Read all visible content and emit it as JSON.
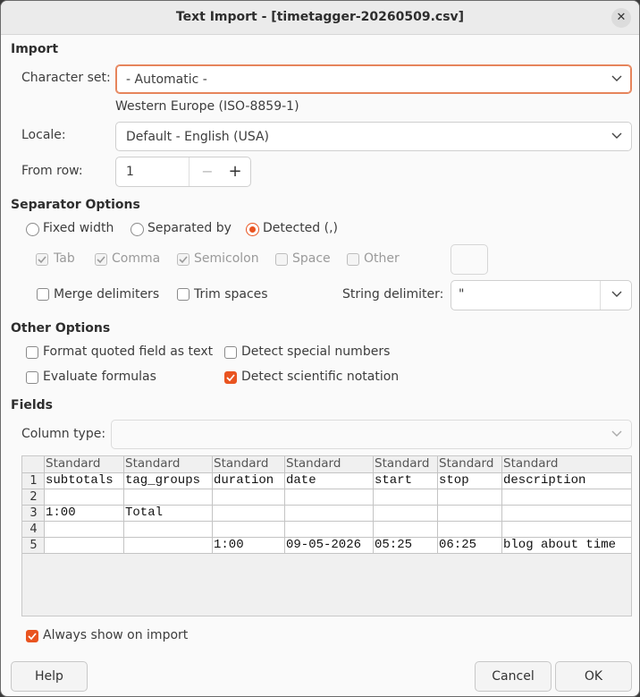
{
  "window": {
    "title": "Text Import - [timetagger-20260509.csv]"
  },
  "import": {
    "section": "Import",
    "charset_label": "Character set:",
    "charset_value": "- Automatic -",
    "charset_detected": "Western Europe (ISO-8859-1)",
    "locale_label": "Locale:",
    "locale_value": "Default - English (USA)",
    "from_row_label": "From row:",
    "from_row_value": "1"
  },
  "separator": {
    "section": "Separator Options",
    "fixed_width": "Fixed width",
    "separated_by": "Separated by",
    "detected": "Detected (,)",
    "selected": "detected",
    "tab": "Tab",
    "comma": "Comma",
    "semicolon": "Semicolon",
    "space": "Space",
    "other": "Other",
    "merge_delimiters": "Merge delimiters",
    "trim_spaces": "Trim spaces",
    "string_delimiter_label": "String delimiter:",
    "string_delimiter_value": "\""
  },
  "other_options": {
    "section": "Other Options",
    "format_quoted": "Format quoted field as text",
    "detect_special": "Detect special numbers",
    "evaluate_formulas": "Evaluate formulas",
    "detect_scientific": "Detect scientific notation"
  },
  "fields": {
    "section": "Fields",
    "column_type_label": "Column type:",
    "column_type_value": "",
    "column_types": [
      "Standard",
      "Standard",
      "Standard",
      "Standard",
      "Standard",
      "Standard",
      "Standard"
    ],
    "row_numbers": [
      "1",
      "2",
      "3",
      "4",
      "5"
    ],
    "rows": [
      [
        "subtotals",
        "tag_groups",
        "duration",
        "date",
        "start",
        "stop",
        "description"
      ],
      [
        "",
        "",
        "",
        "",
        "",
        "",
        ""
      ],
      [
        "1:00",
        "Total",
        "",
        "",
        "",
        "",
        ""
      ],
      [
        "",
        "",
        "",
        "",
        "",
        "",
        ""
      ],
      [
        "",
        "",
        "1:00",
        "09-05-2026",
        "05:25",
        "06:25",
        "blog about time"
      ]
    ]
  },
  "always_show": "Always show on import",
  "buttons": {
    "help": "Help",
    "cancel": "Cancel",
    "ok": "OK"
  },
  "colors": {
    "accent": "#e95420"
  }
}
